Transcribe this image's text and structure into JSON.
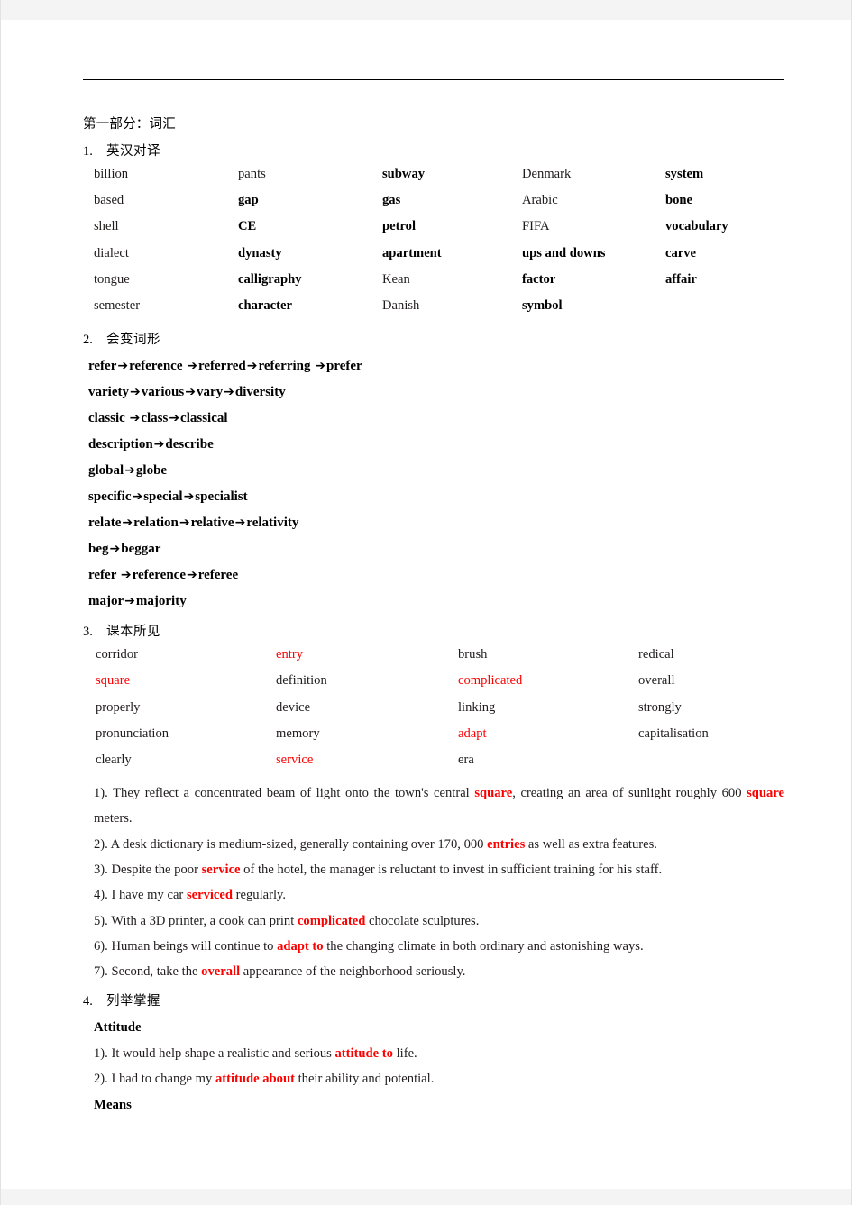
{
  "document": {
    "part_title": "第一部分：词汇"
  },
  "sections": [
    {
      "number": "1.",
      "label": "英汉对译",
      "columns": 5,
      "rows": [
        [
          {
            "text": "billion",
            "bold": false,
            "red": false
          },
          {
            "text": "pants",
            "bold": false,
            "red": false
          },
          {
            "text": "subway",
            "bold": true,
            "red": false
          },
          {
            "text": "Denmark",
            "bold": false,
            "red": false
          },
          {
            "text": "system",
            "bold": true,
            "red": false
          }
        ],
        [
          {
            "text": "based",
            "bold": false,
            "red": false
          },
          {
            "text": "gap",
            "bold": true,
            "red": false
          },
          {
            "text": "gas",
            "bold": true,
            "red": false
          },
          {
            "text": "Arabic",
            "bold": false,
            "red": false
          },
          {
            "text": "bone",
            "bold": true,
            "red": false
          }
        ],
        [
          {
            "text": "shell",
            "bold": false,
            "red": false
          },
          {
            "text": "CE",
            "bold": true,
            "red": false
          },
          {
            "text": "petrol",
            "bold": true,
            "red": false
          },
          {
            "text": "FIFA",
            "bold": false,
            "red": false
          },
          {
            "text": "vocabulary",
            "bold": true,
            "red": false
          }
        ],
        [
          {
            "text": "dialect",
            "bold": false,
            "red": false
          },
          {
            "text": "dynasty",
            "bold": true,
            "red": false
          },
          {
            "text": "apartment",
            "bold": true,
            "red": false
          },
          {
            "text": "ups and downs",
            "bold": true,
            "red": false
          },
          {
            "text": "carve",
            "bold": true,
            "red": false
          }
        ],
        [
          {
            "text": "tongue",
            "bold": false,
            "red": false
          },
          {
            "text": "calligraphy",
            "bold": true,
            "red": false
          },
          {
            "text": "Kean",
            "bold": false,
            "red": false
          },
          {
            "text": "factor",
            "bold": true,
            "red": false
          },
          {
            "text": "affair",
            "bold": true,
            "red": false
          }
        ],
        [
          {
            "text": "semester",
            "bold": false,
            "red": false
          },
          {
            "text": "character",
            "bold": true,
            "red": false
          },
          {
            "text": "Danish",
            "bold": false,
            "red": false
          },
          {
            "text": "symbol",
            "bold": true,
            "red": false
          },
          {
            "text": "",
            "bold": false,
            "red": false
          }
        ]
      ]
    },
    {
      "number": "2.",
      "label": "会变词形",
      "chains": [
        [
          "refer",
          "reference ",
          "referred",
          "referring ",
          "prefer"
        ],
        [
          "variety",
          "various",
          "vary",
          "diversity"
        ],
        [
          "classic ",
          "class",
          "classical"
        ],
        [
          "description",
          "describe"
        ],
        [
          "global",
          "globe"
        ],
        [
          "specific",
          "special",
          "specialist"
        ],
        [
          "relate",
          "relation",
          "relative",
          "relativity"
        ],
        [
          "beg",
          "beggar"
        ],
        [
          "refer ",
          "reference",
          "referee"
        ],
        [
          "major",
          "majority"
        ]
      ],
      "arrow_glyph": "➔"
    },
    {
      "number": "3.",
      "label": "课本所见",
      "columns": 4,
      "rows": [
        [
          {
            "text": "corridor",
            "red": false
          },
          {
            "text": "entry",
            "red": true
          },
          {
            "text": "brush",
            "red": false
          },
          {
            "text": "redical",
            "red": false
          }
        ],
        [
          {
            "text": "square",
            "red": true
          },
          {
            "text": "definition",
            "red": false
          },
          {
            "text": "complicated",
            "red": true
          },
          {
            "text": "overall",
            "red": false
          }
        ],
        [
          {
            "text": "properly",
            "red": false
          },
          {
            "text": "device",
            "red": false
          },
          {
            "text": "linking",
            "red": false
          },
          {
            "text": "strongly",
            "red": false
          }
        ],
        [
          {
            "text": "pronunciation",
            "red": false
          },
          {
            "text": "memory",
            "red": false
          },
          {
            "text": "adapt",
            "red": true
          },
          {
            "text": "capitalisation",
            "red": false
          }
        ],
        [
          {
            "text": "clearly",
            "red": false
          },
          {
            "text": "service",
            "red": true
          },
          {
            "text": "era",
            "red": false
          },
          {
            "text": "",
            "red": false
          }
        ]
      ],
      "sentences": [
        {
          "index": "1).",
          "parts": [
            {
              "t": "They reflect a concentrated beam of light onto the town's central ",
              "hl": false
            },
            {
              "t": "square",
              "hl": true
            },
            {
              "t": ", creating an area of sunlight roughly 600 ",
              "hl": false
            },
            {
              "t": "square",
              "hl": true
            },
            {
              "t": " meters.",
              "hl": false
            }
          ]
        },
        {
          "index": "2).",
          "parts": [
            {
              "t": "A desk dictionary is medium-sized, generally containing over 170, 000 ",
              "hl": false
            },
            {
              "t": "entries",
              "hl": true
            },
            {
              "t": " as well as extra features.",
              "hl": false
            }
          ]
        },
        {
          "index": "3).",
          "parts": [
            {
              "t": "Despite the poor ",
              "hl": false
            },
            {
              "t": "service",
              "hl": true
            },
            {
              "t": " of the hotel, the manager is reluctant to invest in sufficient training for his staff.",
              "hl": false
            }
          ]
        },
        {
          "index": "4).",
          "parts": [
            {
              "t": "I have my car ",
              "hl": false
            },
            {
              "t": "serviced",
              "hl": true
            },
            {
              "t": " regularly.",
              "hl": false
            }
          ]
        },
        {
          "index": "5).",
          "parts": [
            {
              "t": "With a 3D printer, a cook can print ",
              "hl": false
            },
            {
              "t": "complicated",
              "hl": true
            },
            {
              "t": " chocolate sculptures.",
              "hl": false
            }
          ]
        },
        {
          "index": "6).",
          "parts": [
            {
              "t": "Human beings will continue to ",
              "hl": false
            },
            {
              "t": "adapt to",
              "hl": true
            },
            {
              "t": " the changing climate in both ordinary and astonishing ways.",
              "hl": false
            }
          ]
        },
        {
          "index": "7).",
          "parts": [
            {
              "t": "Second, take the ",
              "hl": false
            },
            {
              "t": "overall",
              "hl": true
            },
            {
              "t": " appearance of the neighborhood seriously.",
              "hl": false
            }
          ]
        }
      ]
    },
    {
      "number": "4.",
      "label": "列举掌握",
      "groups": [
        {
          "heading": "Attitude",
          "sentences": [
            {
              "index": "1).",
              "parts": [
                {
                  "t": "It would help shape a realistic and serious ",
                  "hl": false
                },
                {
                  "t": "attitude to",
                  "hl": true
                },
                {
                  "t": " life.",
                  "hl": false
                }
              ]
            },
            {
              "index": "2).",
              "parts": [
                {
                  "t": "I had to change my ",
                  "hl": false
                },
                {
                  "t": "attitude about",
                  "hl": true
                },
                {
                  "t": " their ability and potential.",
                  "hl": false
                }
              ]
            }
          ]
        },
        {
          "heading": "Means",
          "sentences": []
        }
      ]
    }
  ],
  "colors": {
    "highlight_red": "#ff0000",
    "body_text": "#201c1c",
    "rule": "#000000"
  }
}
